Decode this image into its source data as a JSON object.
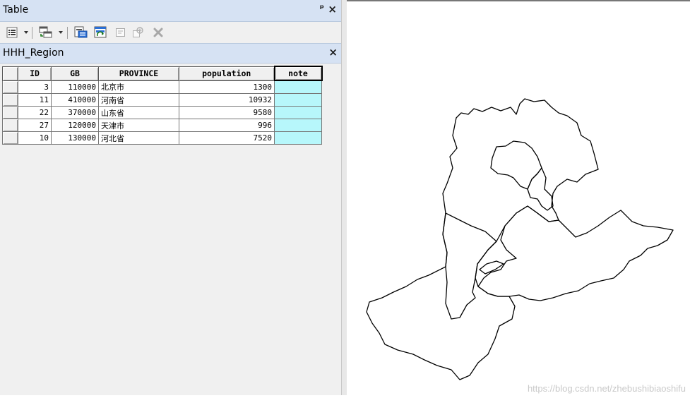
{
  "window": {
    "title": "Table"
  },
  "toolbar": {
    "icons": [
      "table-options-icon",
      "related-tables-icon",
      "select-by-attributes-icon",
      "switch-selection-icon",
      "clear-selection-icon",
      "zoom-to-selected-icon",
      "delete-selected-icon"
    ]
  },
  "table_tab": {
    "name": "HHH_Region"
  },
  "table": {
    "columns": [
      "ID",
      "GB",
      "PROVINCE",
      "population",
      "note"
    ],
    "rows": [
      {
        "id": "3",
        "gb": "110000",
        "province": "北京市",
        "population": "1300",
        "note": ""
      },
      {
        "id": "11",
        "gb": "410000",
        "province": "河南省",
        "population": "10932",
        "note": ""
      },
      {
        "id": "22",
        "gb": "370000",
        "province": "山东省",
        "population": "9580",
        "note": ""
      },
      {
        "id": "27",
        "gb": "120000",
        "province": "天津市",
        "population": "996",
        "note": ""
      },
      {
        "id": "10",
        "gb": "130000",
        "province": "河北省",
        "population": "7520",
        "note": ""
      }
    ],
    "selected_column": "note",
    "note_fill_color": "#b7f7fb"
  },
  "map": {
    "watermark": "https://blog.csdn.net/zhebushibiaoshifu"
  }
}
